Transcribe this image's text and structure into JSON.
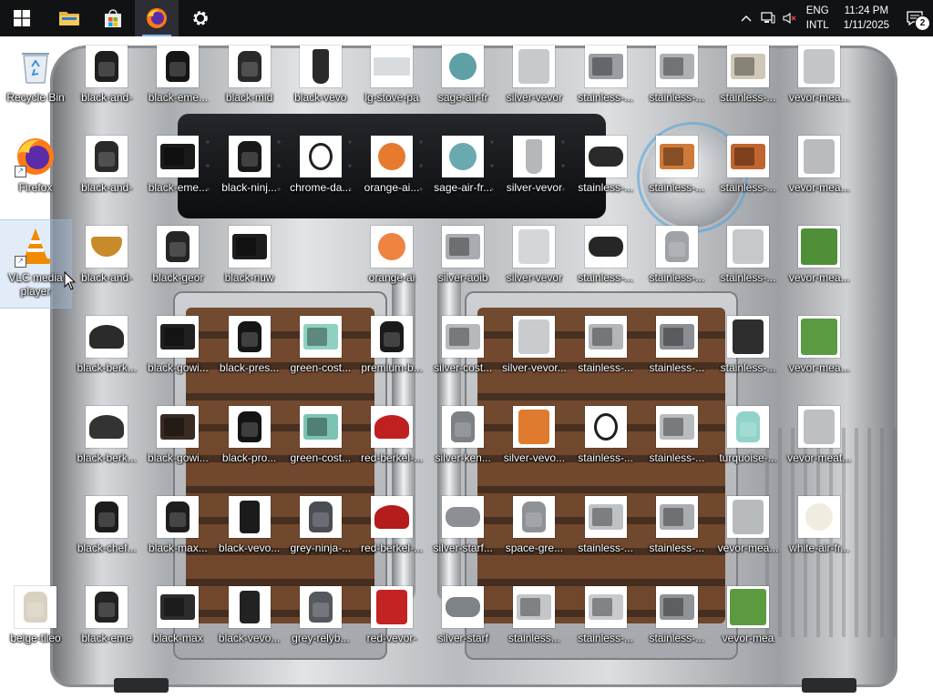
{
  "taskbar": {
    "pinned": [
      {
        "name": "start-button",
        "icon": "windows-logo-icon"
      },
      {
        "name": "file-explorer-button",
        "icon": "folder-icon"
      },
      {
        "name": "microsoft-store-button",
        "icon": "store-bag-icon"
      },
      {
        "name": "firefox-taskbar-button",
        "icon": "firefox-icon",
        "active": true
      },
      {
        "name": "settings-taskbar-button",
        "icon": "gear-icon"
      }
    ],
    "tray": {
      "language_line1": "ENG",
      "language_line2": "INTL",
      "time": "11:24 PM",
      "date": "1/11/2025",
      "notification_count": "2"
    }
  },
  "desktop": {
    "columns": [
      [
        {
          "label": "Recycle Bin",
          "kind": "recycle"
        },
        {
          "label": "Firefox",
          "kind": "firefox",
          "shortcut": true
        },
        {
          "label": "VLC media player",
          "kind": "vlc",
          "shortcut": true,
          "hover": true,
          "wrap": true
        },
        null,
        null,
        null,
        {
          "label": "beige-tileo",
          "kind": "fryer",
          "color": "#d9d2c3"
        }
      ],
      [
        {
          "label": "black-and-",
          "kind": "fryer",
          "color": "#1f1f1f"
        },
        {
          "label": "black-and-",
          "kind": "fryer",
          "color": "#2a2a2a"
        },
        {
          "label": "black-and-",
          "kind": "bowl",
          "color": "#c98a2a"
        },
        {
          "label": "black-berk...",
          "kind": "slicer",
          "color": "#2b2b2b"
        },
        {
          "label": "black-berk...",
          "kind": "slicer",
          "color": "#333333"
        },
        {
          "label": "black-chef...",
          "kind": "fryer",
          "color": "#1c1c1c"
        },
        {
          "label": "black-eme",
          "kind": "fryer",
          "color": "#222222"
        }
      ],
      [
        {
          "label": "black-eme...",
          "kind": "fryer",
          "color": "#151515"
        },
        {
          "label": "black-eme...",
          "kind": "box",
          "color": "#1a1a1a"
        },
        {
          "label": "black-geor",
          "kind": "fryer",
          "color": "#262626"
        },
        {
          "label": "black-gowi...",
          "kind": "box",
          "color": "#202020"
        },
        {
          "label": "black-gowi...",
          "kind": "box",
          "color": "#3a2a22"
        },
        {
          "label": "black-max...",
          "kind": "fryer",
          "color": "#1e1e1e"
        },
        {
          "label": "black-max",
          "kind": "box",
          "color": "#2c2c2c"
        }
      ],
      [
        {
          "label": "black-mid",
          "kind": "fryer",
          "color": "#2a2a2a"
        },
        {
          "label": "black-ninj...",
          "kind": "fryer",
          "color": "#181818"
        },
        {
          "label": "black-nuw",
          "kind": "box",
          "color": "#1d1d1d"
        },
        {
          "label": "black-pres...",
          "kind": "fryer",
          "color": "#161616"
        },
        {
          "label": "black-pro...",
          "kind": "fryer",
          "color": "#141414"
        },
        {
          "label": "black-vevo...",
          "kind": "tall",
          "color": "#1b1b1b"
        },
        {
          "label": "black-vevo...",
          "kind": "tall",
          "color": "#222222"
        }
      ],
      [
        {
          "label": "black-vevo",
          "kind": "blender",
          "color": "#2a2a2a"
        },
        {
          "label": "chrome-da...",
          "kind": "cable",
          "color": "#222222"
        },
        null,
        {
          "label": "green-cost...",
          "kind": "box",
          "color": "#8fd1c1"
        },
        {
          "label": "green-cost...",
          "kind": "box",
          "color": "#7cc4b2"
        },
        {
          "label": "grey-ninja-...",
          "kind": "fryer",
          "color": "#4a4d52"
        },
        {
          "label": "grey-relyb...",
          "kind": "fryer",
          "color": "#55585d"
        }
      ],
      [
        {
          "label": "lg-stove-pa",
          "kind": "tray",
          "color": "#d9dcdf"
        },
        {
          "label": "orange-ai...",
          "kind": "round",
          "color": "#e67a2e"
        },
        {
          "label": "orange-ai",
          "kind": "round",
          "color": "#ee8440"
        },
        {
          "label": "premium-b...",
          "kind": "fryer",
          "color": "#1a1a1a"
        },
        {
          "label": "red-berkel-...",
          "kind": "slicer",
          "color": "#c0201f"
        },
        {
          "label": "red-berkel-...",
          "kind": "slicer",
          "color": "#b51c1c"
        },
        {
          "label": "red-vevor-",
          "kind": "machine",
          "color": "#c42323"
        }
      ],
      [
        {
          "label": "sage-air-fr",
          "kind": "round",
          "color": "#5f9fa6"
        },
        {
          "label": "sage-air-fr...",
          "kind": "round",
          "color": "#6aa9b0"
        },
        {
          "label": "silver-aoib",
          "kind": "box",
          "color": "#a8abaf"
        },
        {
          "label": "silver-cost...",
          "kind": "box",
          "color": "#b7babd"
        },
        {
          "label": "silver-ken...",
          "kind": "fryer",
          "color": "#7d8084"
        },
        {
          "label": "silver-starf...",
          "kind": "grill",
          "color": "#8c8f93"
        },
        {
          "label": "silver-starf",
          "kind": "grill",
          "color": "#7f8286"
        }
      ],
      [
        {
          "label": "silver-vevor",
          "kind": "machine",
          "color": "#c7c9cc"
        },
        {
          "label": "silver-vevor",
          "kind": "blender",
          "color": "#b5b8bb"
        },
        {
          "label": "silver-vevor",
          "kind": "machine",
          "color": "#d4d6d8"
        },
        {
          "label": "silver-vevor...",
          "kind": "machine",
          "color": "#c9cbce"
        },
        {
          "label": "silver-vevo...",
          "kind": "machine",
          "color": "#e07a2e"
        },
        {
          "label": "space-gre...",
          "kind": "fryer",
          "color": "#8e9196"
        },
        {
          "label": "stainless...",
          "kind": "box",
          "color": "#c4c6c9"
        }
      ],
      [
        {
          "label": "stainless-...",
          "kind": "box",
          "color": "#9a9da1"
        },
        {
          "label": "stainless-...",
          "kind": "grill",
          "color": "#2a2a2a"
        },
        {
          "label": "stainless-...",
          "kind": "grill",
          "color": "#262626"
        },
        {
          "label": "stainless-...",
          "kind": "box",
          "color": "#b3b6b9"
        },
        {
          "label": "stainless-...",
          "kind": "cable",
          "color": "#1e1e1e"
        },
        {
          "label": "stainless-...",
          "kind": "box",
          "color": "#bfc2c5"
        },
        {
          "label": "stainless-...",
          "kind": "box",
          "color": "#c8cacd"
        }
      ],
      [
        {
          "label": "stainless-...",
          "kind": "box",
          "color": "#aeb1b4"
        },
        {
          "label": "stainless-...",
          "kind": "box",
          "color": "#cf7a3a"
        },
        {
          "label": "stainless-...",
          "kind": "fryer",
          "color": "#9fa2a6"
        },
        {
          "label": "stainless-...",
          "kind": "box",
          "color": "#8a8d91"
        },
        {
          "label": "stainless-...",
          "kind": "box",
          "color": "#b9bcbf"
        },
        {
          "label": "stainless-...",
          "kind": "box",
          "color": "#a9acb0"
        },
        {
          "label": "stainless-...",
          "kind": "box",
          "color": "#8f9296"
        }
      ],
      [
        {
          "label": "stainless-...",
          "kind": "box",
          "color": "#cfc8b8"
        },
        {
          "label": "stainless-...",
          "kind": "box",
          "color": "#c0652f"
        },
        {
          "label": "stainless-...",
          "kind": "machine",
          "color": "#c6c8cb"
        },
        {
          "label": "stainless-...",
          "kind": "machine",
          "color": "#2e2e2e"
        },
        {
          "label": "turquoise-...",
          "kind": "fryer",
          "color": "#8fd3c9"
        },
        {
          "label": "vevor-mea...",
          "kind": "machine",
          "color": "#b8bbbe"
        },
        {
          "label": "vevor-mea",
          "kind": "plant",
          "color": "#5c9a3f"
        }
      ],
      [
        {
          "label": "vevor-mea...",
          "kind": "machine",
          "color": "#c3c5c8"
        },
        {
          "label": "vevor-mea...",
          "kind": "machine",
          "color": "#b9bbbe"
        },
        {
          "label": "vevor-mea...",
          "kind": "plant",
          "color": "#4e8f37"
        },
        {
          "label": "vevor-mea...",
          "kind": "plant",
          "color": "#5a9b42"
        },
        {
          "label": "vevor-meat...",
          "kind": "machine",
          "color": "#bdbfc2"
        },
        {
          "label": "white-air-fr...",
          "kind": "round",
          "color": "#f1ece0"
        },
        null
      ]
    ]
  }
}
